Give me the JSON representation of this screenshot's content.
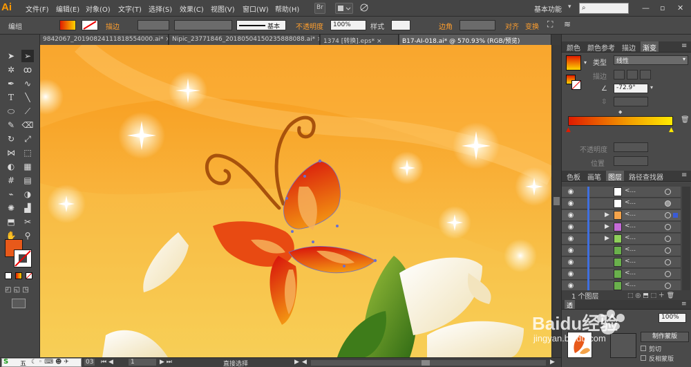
{
  "app": {
    "logo": "Ai"
  },
  "menu": [
    "文件(F)",
    "编辑(E)",
    "对象(O)",
    "文字(T)",
    "选择(S)",
    "效果(C)",
    "视图(V)",
    "窗口(W)",
    "帮助(H)"
  ],
  "menubar_icons": {
    "bridge": "Br"
  },
  "workspace": {
    "label": "基本功能",
    "search_placeholder": ""
  },
  "control_bar": {
    "selection_label": "编组",
    "stroke_label": "描边",
    "stroke_style_label": "基本",
    "opacity_label": "不透明度",
    "opacity_value": "100%",
    "style_label": "样式",
    "corner_label": "边角",
    "align_label": "对齐",
    "transform_label": "变换"
  },
  "tabs": [
    {
      "label": "9842067_20190824111818554000.ai* ×",
      "active": false
    },
    {
      "label": "Nipic_23771846_20180504150235888088.ai* ×",
      "active": false
    },
    {
      "label": "1374 [转换].eps* ×",
      "active": false
    },
    {
      "label": "B17-AI-018.ai* @ 570.93% (RGB/预览)",
      "active": true
    }
  ],
  "right_panel": {
    "tabs_top": [
      "颜色",
      "颜色参考",
      "描边",
      "渐变"
    ],
    "gradient": {
      "type_label": "类型",
      "type_value": "线性",
      "stroke_label": "描边",
      "angle_value": "-72.9°",
      "opacity_label": "不透明度",
      "location_label": "位置",
      "start_color": "#e01b00",
      "end_color": "#ffea00"
    },
    "tabs_layers": [
      "色板",
      "画笔",
      "图层",
      "路径查找器"
    ],
    "layer_name": "<...",
    "layers_footer": "1 个图层",
    "bottom_panel": {
      "opacity_label": "透",
      "opacity_value": "100%",
      "make_mask": "制作蒙版",
      "clip": "剪切",
      "invert_mask": "反相蒙版"
    }
  },
  "status_bar": {
    "zoom": "03",
    "page": "1",
    "tool": "直接选择"
  },
  "ime_bar": {
    "label": "五"
  },
  "watermark": {
    "brand": "Baidu经验",
    "url": "jingyan.baidu.com"
  },
  "colors": {
    "accent": "#ff9f2e",
    "fill_color": "#e8591a",
    "canvas_top": "#f79f1f",
    "canvas_bottom": "#f6d85a"
  }
}
